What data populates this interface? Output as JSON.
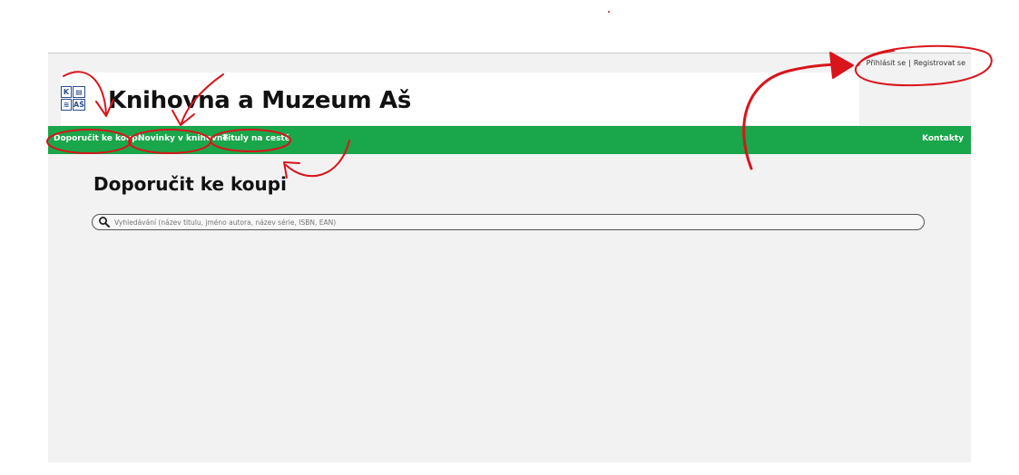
{
  "auth": {
    "login": "Přihlásit se",
    "separator": "|",
    "register": "Registrovat se"
  },
  "logo": {
    "cells": [
      "K",
      "▤",
      "≋",
      "AŠ"
    ]
  },
  "site": {
    "title": "Knihovna a Muzeum Aš"
  },
  "nav": {
    "items": [
      {
        "label": "Doporučit ke koupi"
      },
      {
        "label": "Novinky v knihovně"
      },
      {
        "label": "Tituly na cestě"
      }
    ],
    "contacts": "Kontakty"
  },
  "page": {
    "heading": "Doporučit ke koupi"
  },
  "search": {
    "placeholder": "Vyhledávání (název titulu, jméno autora, název série, ISBN, EAN)",
    "icon": "search-icon"
  },
  "colors": {
    "nav": "#1aa64a",
    "annotation": "#d9141b",
    "background": "#f2f2f2"
  }
}
